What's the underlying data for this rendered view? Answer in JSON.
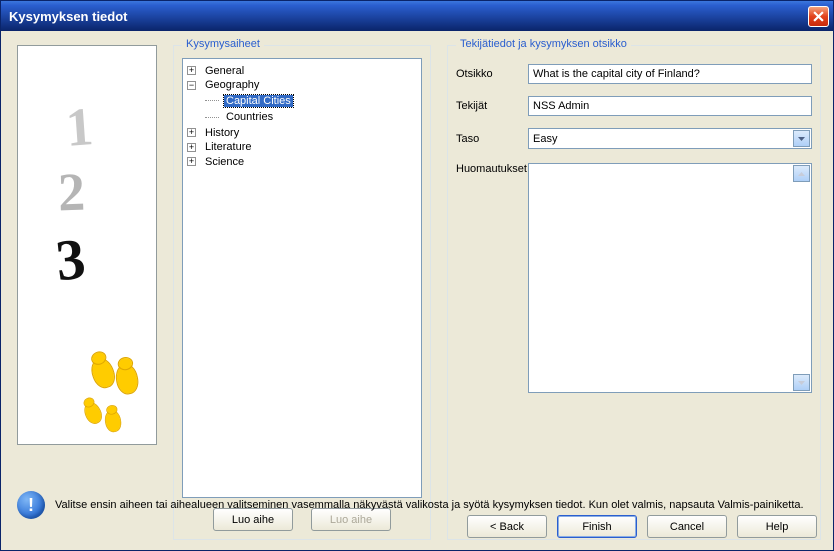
{
  "window": {
    "title": "Kysymyksen tiedot"
  },
  "topics": {
    "title": "Kysymysaiheet",
    "items": [
      {
        "label": "General",
        "expander": "+"
      },
      {
        "label": "Geography",
        "expander": "−",
        "children": [
          {
            "label": "Capital Cities",
            "selected": true
          },
          {
            "label": "Countries"
          }
        ]
      },
      {
        "label": "History",
        "expander": "+"
      },
      {
        "label": "Literature",
        "expander": "+"
      },
      {
        "label": "Science",
        "expander": "+"
      }
    ],
    "btn_create": "Luo aihe",
    "btn_create2": "Luo aihe"
  },
  "details": {
    "title": "Tekijätiedot ja kysymyksen otsikko",
    "label_title": "Otsikko",
    "value_title": "What is the capital city of Finland?",
    "label_authors": "Tekijät",
    "value_authors": "NSS Admin",
    "label_level": "Taso",
    "value_level": "Easy",
    "label_notes": "Huomautukset"
  },
  "info": {
    "text": "Valitse ensin aiheen tai aihealueen valitseminen vasemmalla näkyvästä valikosta ja syötä kysymyksen tiedot. Kun olet valmis, napsauta Valmis-painiketta."
  },
  "buttons": {
    "back": "< Back",
    "finish": "Finish",
    "cancel": "Cancel",
    "help": "Help"
  }
}
